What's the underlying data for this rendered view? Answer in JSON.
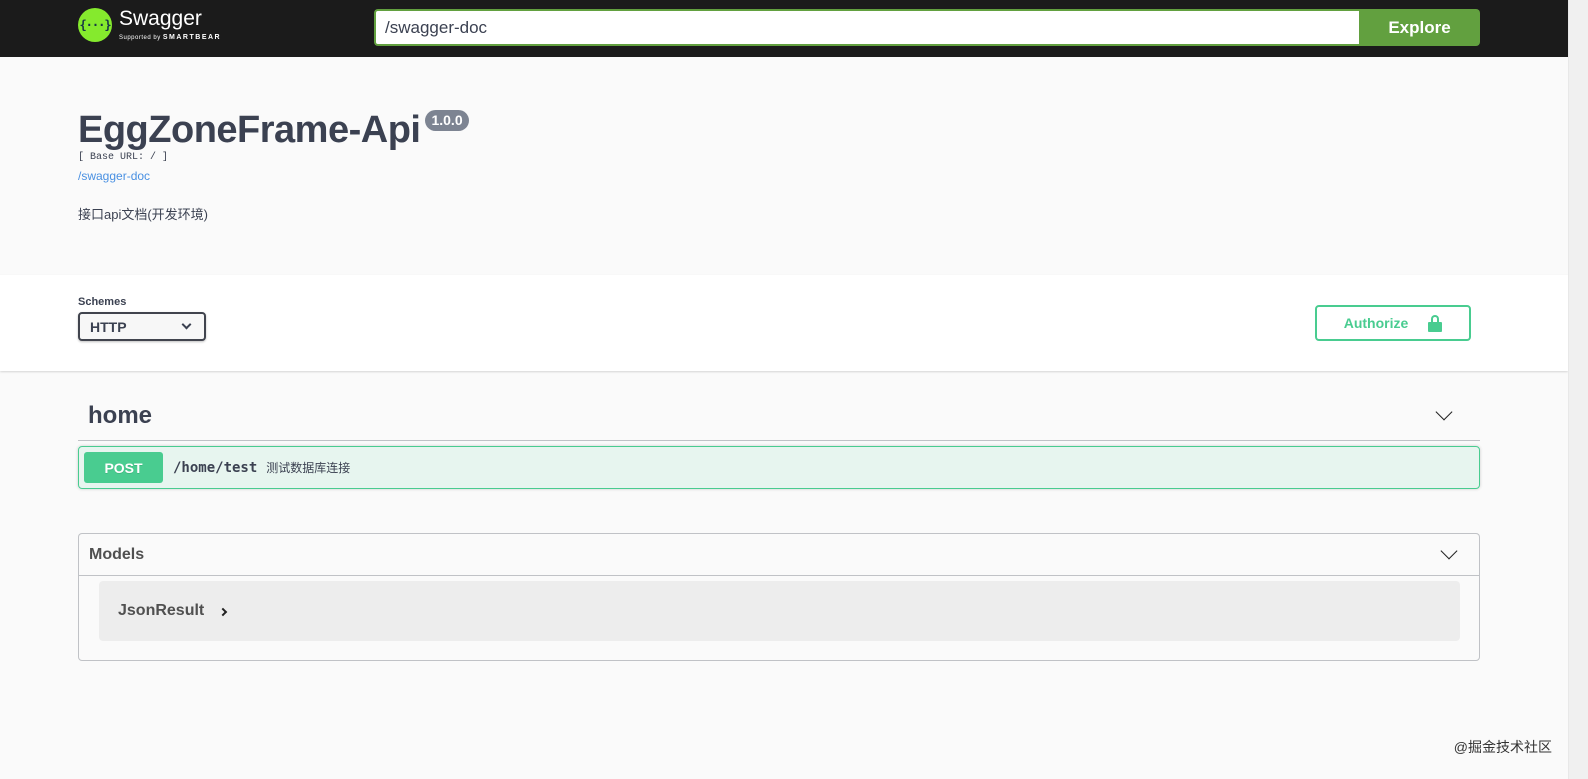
{
  "topbar": {
    "logo_title": "Swagger",
    "logo_supported_by": "Supported by",
    "logo_brand": "SMARTBEAR",
    "logo_icon": "swagger-braces-icon",
    "url_value": "/swagger-doc",
    "explore_label": "Explore"
  },
  "info": {
    "title": "EggZoneFrame-Api",
    "version": "1.0.0",
    "base_url": "[ Base URL: / ]",
    "doc_link": "/swagger-doc",
    "description": "接口api文档(开发环境)"
  },
  "schemes": {
    "label": "Schemes",
    "selected": "HTTP",
    "authorize_label": "Authorize",
    "authorize_icon": "unlock-icon"
  },
  "tags": [
    {
      "name": "home",
      "operations": [
        {
          "method": "POST",
          "path": "/home/test",
          "summary": "测试数据库连接"
        }
      ]
    }
  ],
  "models": {
    "title": "Models",
    "items": [
      {
        "name": "JsonResult"
      }
    ]
  },
  "watermark": "@掘金技术社区",
  "colors": {
    "topbar_bg": "#1b1b1b",
    "explore_green": "#62a03f",
    "post_green": "#49cc90",
    "text": "#3b4151",
    "link": "#4990e2"
  }
}
